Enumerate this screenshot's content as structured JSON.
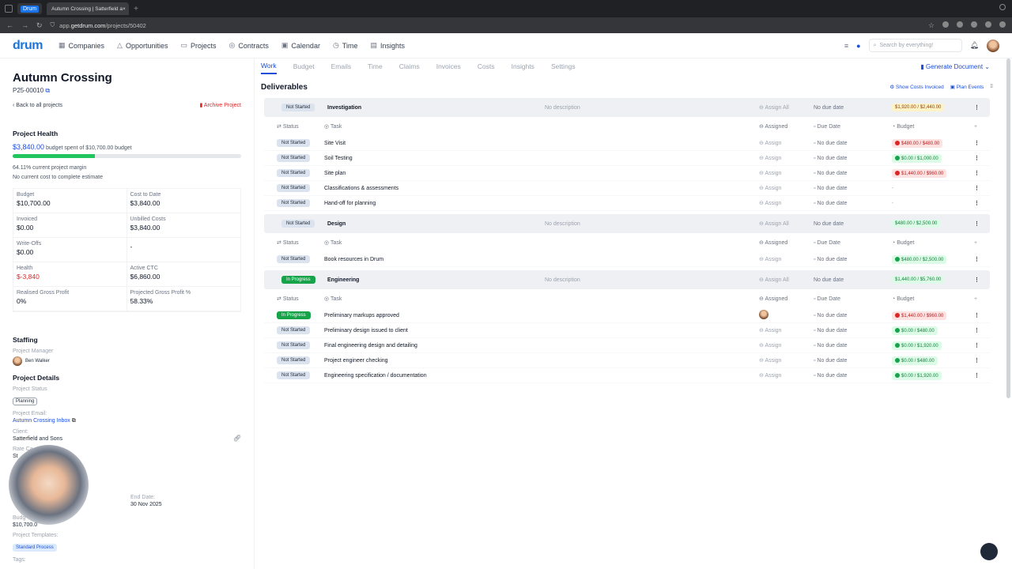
{
  "browser": {
    "tab1_label": "Drum",
    "tab2_label": "Autumn Crossing | Satterfield a",
    "url_prefix": "app.",
    "url_host": "getdrum.com",
    "url_path": "/projects/50402"
  },
  "nav": {
    "logo": "drum",
    "items": [
      "Companies",
      "Opportunities",
      "Projects",
      "Contracts",
      "Calendar",
      "Time",
      "Insights"
    ],
    "search_placeholder": "Search by everything!"
  },
  "project": {
    "title": "Autumn Crossing",
    "code": "P25-00010",
    "back": "Back to all projects",
    "archive": "Archive Project"
  },
  "health": {
    "title": "Project Health",
    "spent": "$3,840.00",
    "spent_text": "budget spent of $10,700.00 budget",
    "progress": 0.359,
    "margin": "64.11% current project margin",
    "ctc": "No current cost to complete estimate"
  },
  "stats": [
    {
      "label": "Budget",
      "value": "$10,700.00"
    },
    {
      "label": "Cost to Date",
      "value": "$3,840.00"
    },
    {
      "label": "Invoiced",
      "value": "$0.00"
    },
    {
      "label": "Unbilled Costs",
      "value": "$3,840.00"
    },
    {
      "label": "Write-Offs",
      "value": "$0.00"
    },
    {
      "label": "",
      "value": "-"
    },
    {
      "label": "Health",
      "value": "$-3,840"
    },
    {
      "label": "Active CTC",
      "value": "$6,860.00"
    },
    {
      "label": "Realised Gross Profit",
      "value": "0%"
    },
    {
      "label": "Projected Gross Profit %",
      "value": "58.33%"
    }
  ],
  "staffing": {
    "title": "Staffing",
    "pm_label": "Project Manager",
    "pm_name": "Ben Walker"
  },
  "details": {
    "title": "Project Details",
    "status_label": "Project Status",
    "status": "Planning",
    "email_label": "Project Email:",
    "email": "Autumn Crossing Inbox",
    "client_label": "Client:",
    "client": "Satterfield and Sons",
    "rate_label": "Rate Ca",
    "rate": "St",
    "end_label": "End Date:",
    "end": "30 Nov 2025",
    "budget_label": "Budg",
    "budget": "$10,700.0",
    "templates_label": "Project Templates:",
    "template": "Standard Process",
    "tags_label": "Tags:"
  },
  "tabs": [
    "Work",
    "Budget",
    "Emails",
    "Time",
    "Claims",
    "Invoices",
    "Costs",
    "Insights",
    "Settings"
  ],
  "generate": "Generate Document",
  "deliverables": {
    "title": "Deliverables",
    "show_costs": "Show Costs Invoiced",
    "plan_events": "Plan Events"
  },
  "headers": {
    "status": "Status",
    "task": "Task",
    "assigned": "Assigned",
    "due": "Due Date",
    "budget": "Budget"
  },
  "groups": [
    {
      "status": "Not Started",
      "name": "Investigation",
      "desc": "No description",
      "assign": "Assign All",
      "due": "No due date",
      "budget": "$1,920.00 / $2,440.00",
      "btype": "yel",
      "tasks": [
        {
          "status": "Not Started",
          "name": "Site Visit",
          "assign": "Assign",
          "due": "No due date",
          "budget": "$480.00 / $480.00",
          "btype": "red"
        },
        {
          "status": "Not Started",
          "name": "Soil Testing",
          "assign": "Assign",
          "due": "No due date",
          "budget": "$0.00 / $1,000.00",
          "btype": "green"
        },
        {
          "status": "Not Started",
          "name": "Site plan",
          "assign": "Assign",
          "due": "No due date",
          "budget": "$1,440.00 / $960.00",
          "btype": "red"
        },
        {
          "status": "Not Started",
          "name": "Classifications & assessments",
          "assign": "Assign",
          "due": "No due date",
          "budget": "-",
          "btype": "none"
        },
        {
          "status": "Not Started",
          "name": "Hand-off for planning",
          "assign": "Assign",
          "due": "No due date",
          "budget": "-",
          "btype": "none"
        }
      ]
    },
    {
      "status": "Not Started",
      "name": "Design",
      "desc": "No description",
      "assign": "Assign All",
      "due": "No due date",
      "budget": "$480.00 / $2,500.00",
      "btype": "gb",
      "tasks": [
        {
          "status": "Not Started",
          "name": "Book resources in Drum",
          "assign": "Assign",
          "due": "No due date",
          "budget": "$480.00 / $2,500.00",
          "btype": "green"
        }
      ]
    },
    {
      "status": "In Progress",
      "name": "Engineering",
      "desc": "No description",
      "assign": "Assign All",
      "due": "No due date",
      "budget": "$1,440.00 / $5,760.00",
      "btype": "gb",
      "tasks": [
        {
          "status": "In Progress",
          "name": "Preliminary markups approved",
          "assign": "",
          "due": "No due date",
          "budget": "$1,440.00 / $960.00",
          "btype": "red"
        },
        {
          "status": "Not Started",
          "name": "Preliminary design issued to client",
          "assign": "Assign",
          "due": "No due date",
          "budget": "$0.00 / $480.00",
          "btype": "green"
        },
        {
          "status": "Not Started",
          "name": "Final engineering design and detailing",
          "assign": "Assign",
          "due": "No due date",
          "budget": "$0.00 / $1,920.00",
          "btype": "green"
        },
        {
          "status": "Not Started",
          "name": "Project engineer checking",
          "assign": "Assign",
          "due": "No due date",
          "budget": "$0.00 / $480.00",
          "btype": "green"
        },
        {
          "status": "Not Started",
          "name": "Engineering specification / documentation",
          "assign": "Assign",
          "due": "No due date",
          "budget": "$0.00 / $1,920.00",
          "btype": "green"
        }
      ]
    }
  ]
}
